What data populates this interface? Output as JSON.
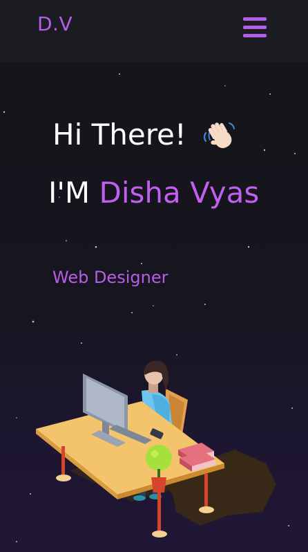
{
  "header": {
    "logo": "D.V",
    "menu_icon": "hamburger-menu-icon"
  },
  "hero": {
    "greeting": "Hi There!",
    "greeting_icon": "waving-hand-icon",
    "intro_prefix": "I'M",
    "name": "Disha Vyas",
    "role": "Web Designer",
    "illustration": "woman-working-at-desk-illustration"
  },
  "colors": {
    "accent": "#b65ee8",
    "name": "#c25ef0",
    "navbar_bg": "#1b1c22",
    "page_bg": "#16151c"
  }
}
